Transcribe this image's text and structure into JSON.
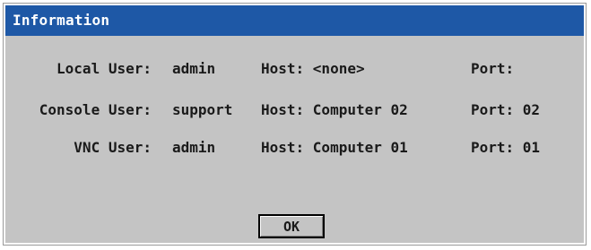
{
  "window": {
    "title": "Information"
  },
  "rows": [
    {
      "label": "Local User:",
      "user": "admin",
      "host": "Host: <none>",
      "port": "Port:"
    },
    {
      "label": "Console User:",
      "user": "support",
      "host": "Host: Computer 02",
      "port": "Port: 02"
    },
    {
      "label": "VNC User:",
      "user": "admin",
      "host": "Host: Computer 01",
      "port": "Port: 01"
    }
  ],
  "buttons": {
    "ok_label": "OK"
  },
  "colors": {
    "titlebar": "#1e58a6",
    "dialog_bg": "#c4c4c4",
    "text": "#1a1a1a"
  }
}
